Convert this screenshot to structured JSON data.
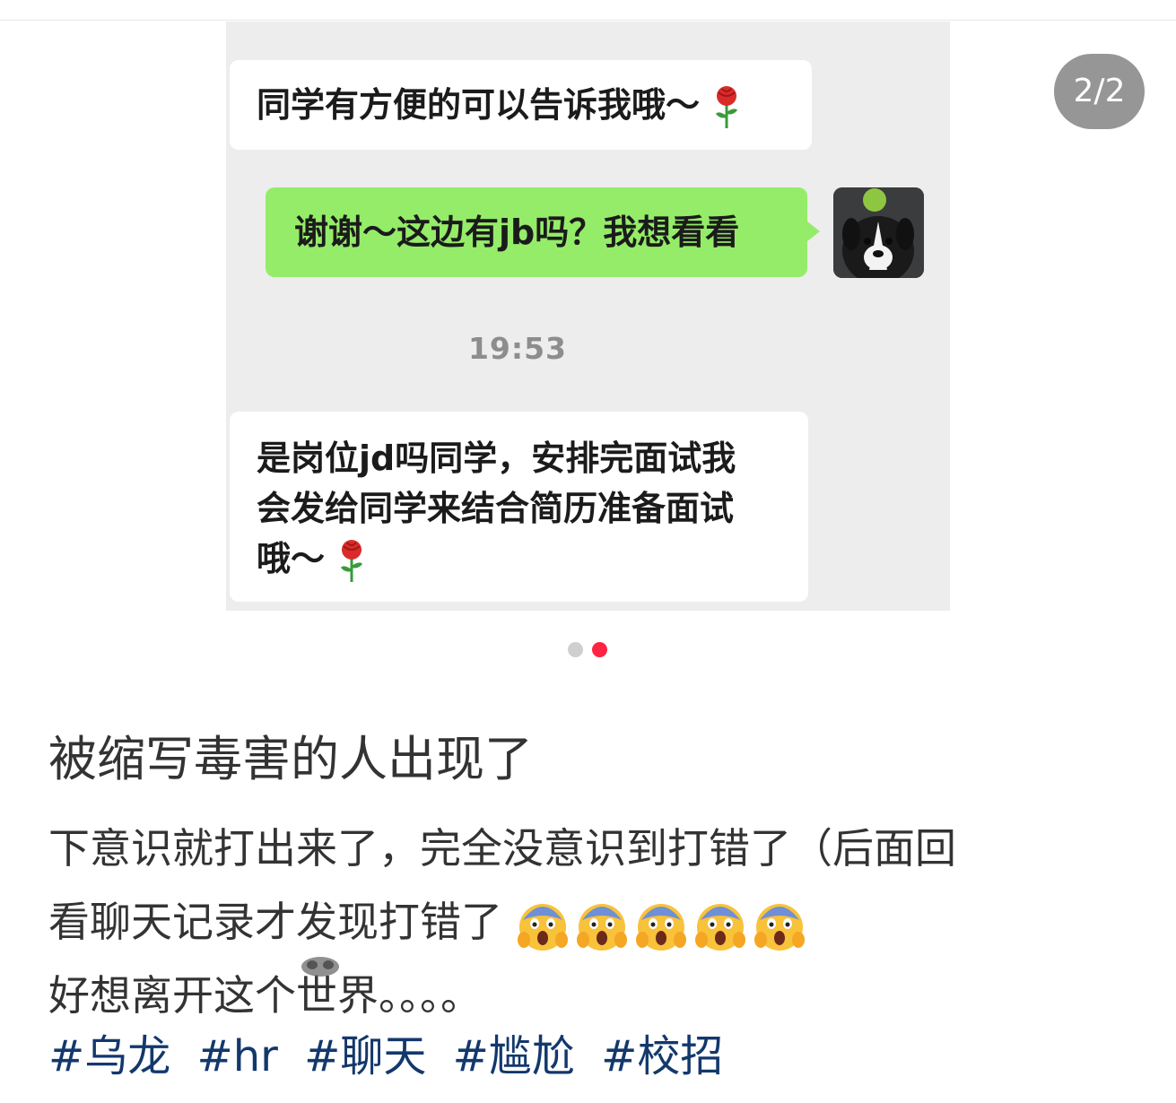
{
  "carousel": {
    "counter": "2/2",
    "messages": {
      "msg1": "同学有方便的可以告诉我哦～",
      "msg2": "谢谢～这边有jb吗？我想看看",
      "timestamp": "19:53",
      "msg3_line1": "是岗位jd吗同学，安排完面试我",
      "msg3_line2": "会发给同学来结合简历准备面试",
      "msg3_line3": "哦～"
    },
    "dots": {
      "count": 2,
      "active_index": 1
    }
  },
  "post": {
    "title": "被缩写毒害的人出现了",
    "body_line1": "下意识就打出来了，完全没意识到打错了（后面回",
    "body_line2": "看聊天记录才发现打错了",
    "body_line3_a": "好想离开这个",
    "body_line3_b": "世界。。。。",
    "tags": [
      "#乌龙",
      "#hr",
      "#聊天",
      "#尴尬",
      "#校招"
    ]
  },
  "colors": {
    "chat_bg": "#ededed",
    "green_bubble": "#95ec69",
    "active_dot": "#ff2442",
    "tag_color": "#13386c"
  }
}
